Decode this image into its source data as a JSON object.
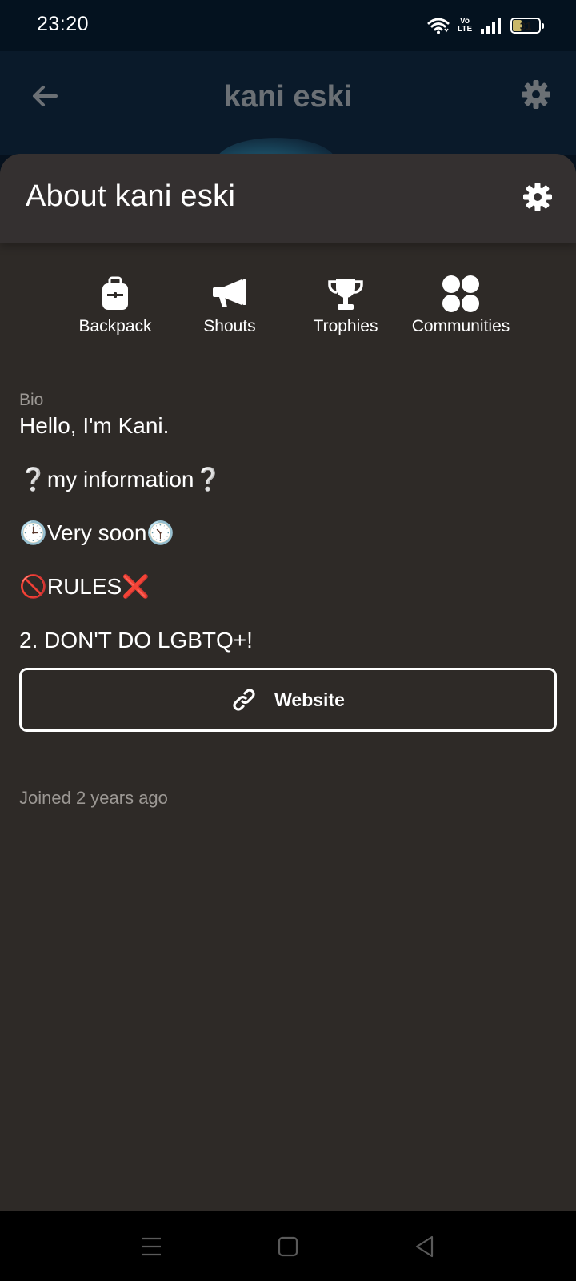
{
  "status_bar": {
    "time": "23:20",
    "volte": "Vo LTE",
    "battery": "31",
    "battery_level": 0.31,
    "icons": [
      "wifi-icon",
      "volte-icon",
      "signal-icon",
      "battery-icon"
    ]
  },
  "profile_header": {
    "title": "kani eski",
    "back_icon": "arrow-left-icon",
    "settings_icon": "gear-icon"
  },
  "sheet": {
    "title": "About kani eski",
    "settings_icon": "gear-icon",
    "quick_links": [
      {
        "label": "Backpack",
        "icon": "backpack-icon"
      },
      {
        "label": "Shouts",
        "icon": "megaphone-icon"
      },
      {
        "label": "Trophies",
        "icon": "trophy-icon"
      },
      {
        "label": "Communities",
        "icon": "communities-icon"
      }
    ],
    "bio_label": "Bio",
    "bio_lines": [
      "Hello, I'm Kani.",
      "❔my information❔",
      "🕒Very soon🕥",
      "🚫RULES❌",
      "2. DON'T DO LGBTQ+!"
    ],
    "website_label": "Website",
    "website_icon": "link-icon",
    "joined": "Joined 2 years ago"
  },
  "nav_bar": {
    "buttons": [
      "menu-icon",
      "home-icon",
      "back-icon"
    ]
  },
  "colors": {
    "sheet_bg": "#2e2a27",
    "sheet_header_bg": "#343030",
    "muted_text": "#9c9894",
    "header_bg": "#06111d"
  }
}
